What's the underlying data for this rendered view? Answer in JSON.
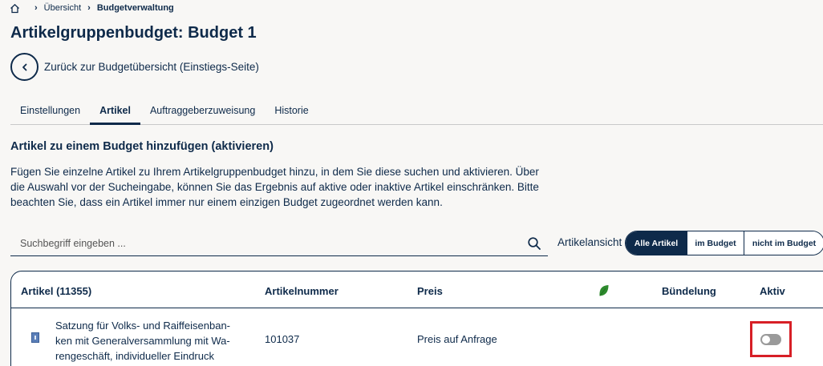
{
  "breadcrumb": {
    "home_icon": "home-icon",
    "items": [
      "Übersicht",
      "Budgetverwaltung"
    ]
  },
  "page": {
    "title": "Artikelgruppenbudget: Budget 1",
    "back_label": "Zurück zur Budgetübersicht (Einstiegs-Seite)"
  },
  "tabs": [
    {
      "label": "Einstellungen",
      "active": false
    },
    {
      "label": "Artikel",
      "active": true
    },
    {
      "label": "Auftraggeberzuweisung",
      "active": false
    },
    {
      "label": "Historie",
      "active": false
    }
  ],
  "section": {
    "title": "Artikel zu einem Budget hinzufügen (aktivieren)",
    "description": "Fügen Sie einzelne Artikel zu Ihrem Artikelgruppenbudget hinzu, in dem Sie diese suchen und aktivieren. Über die Auswahl vor der Sucheingabe, können Sie das Ergebnis auf aktive oder inaktive Artikel einschränken. Bitte beachten Sie, dass ein Artikel immer nur einem einzigen Budget zugeordnet werden kann."
  },
  "search": {
    "placeholder": "Suchbegriff eingeben ...",
    "value": ""
  },
  "view_filter": {
    "label": "Artikelansicht",
    "options": [
      "Alle Artikel",
      "im Budget",
      "nicht im Budget"
    ],
    "selected": "Alle Artikel"
  },
  "table": {
    "headers": {
      "article": "Artikel (11355)",
      "number": "Artikelnummer",
      "price": "Preis",
      "bundling": "Bündelung",
      "active": "Aktiv"
    },
    "rows": [
      {
        "name": "Satzung für Volks- und Raiffeisenbanken mit Generalversammlung mit Warengeschäft, individueller Eindruck",
        "name_lines": [
          "Satzung für Volks- und Raiffeisenban-",
          "ken mit Generalversammlung mit Wa-",
          "rengeschäft, individueller Eindruck"
        ],
        "number": "101037",
        "price": "Preis auf Anfrage",
        "bundling": "",
        "active": false
      }
    ]
  },
  "colors": {
    "primary": "#0e2a4a",
    "background": "#f8f7f5",
    "leaf_green": "#2e8b2e",
    "highlight_red": "#d71f26",
    "toggle_off": "#9a9a9a"
  }
}
